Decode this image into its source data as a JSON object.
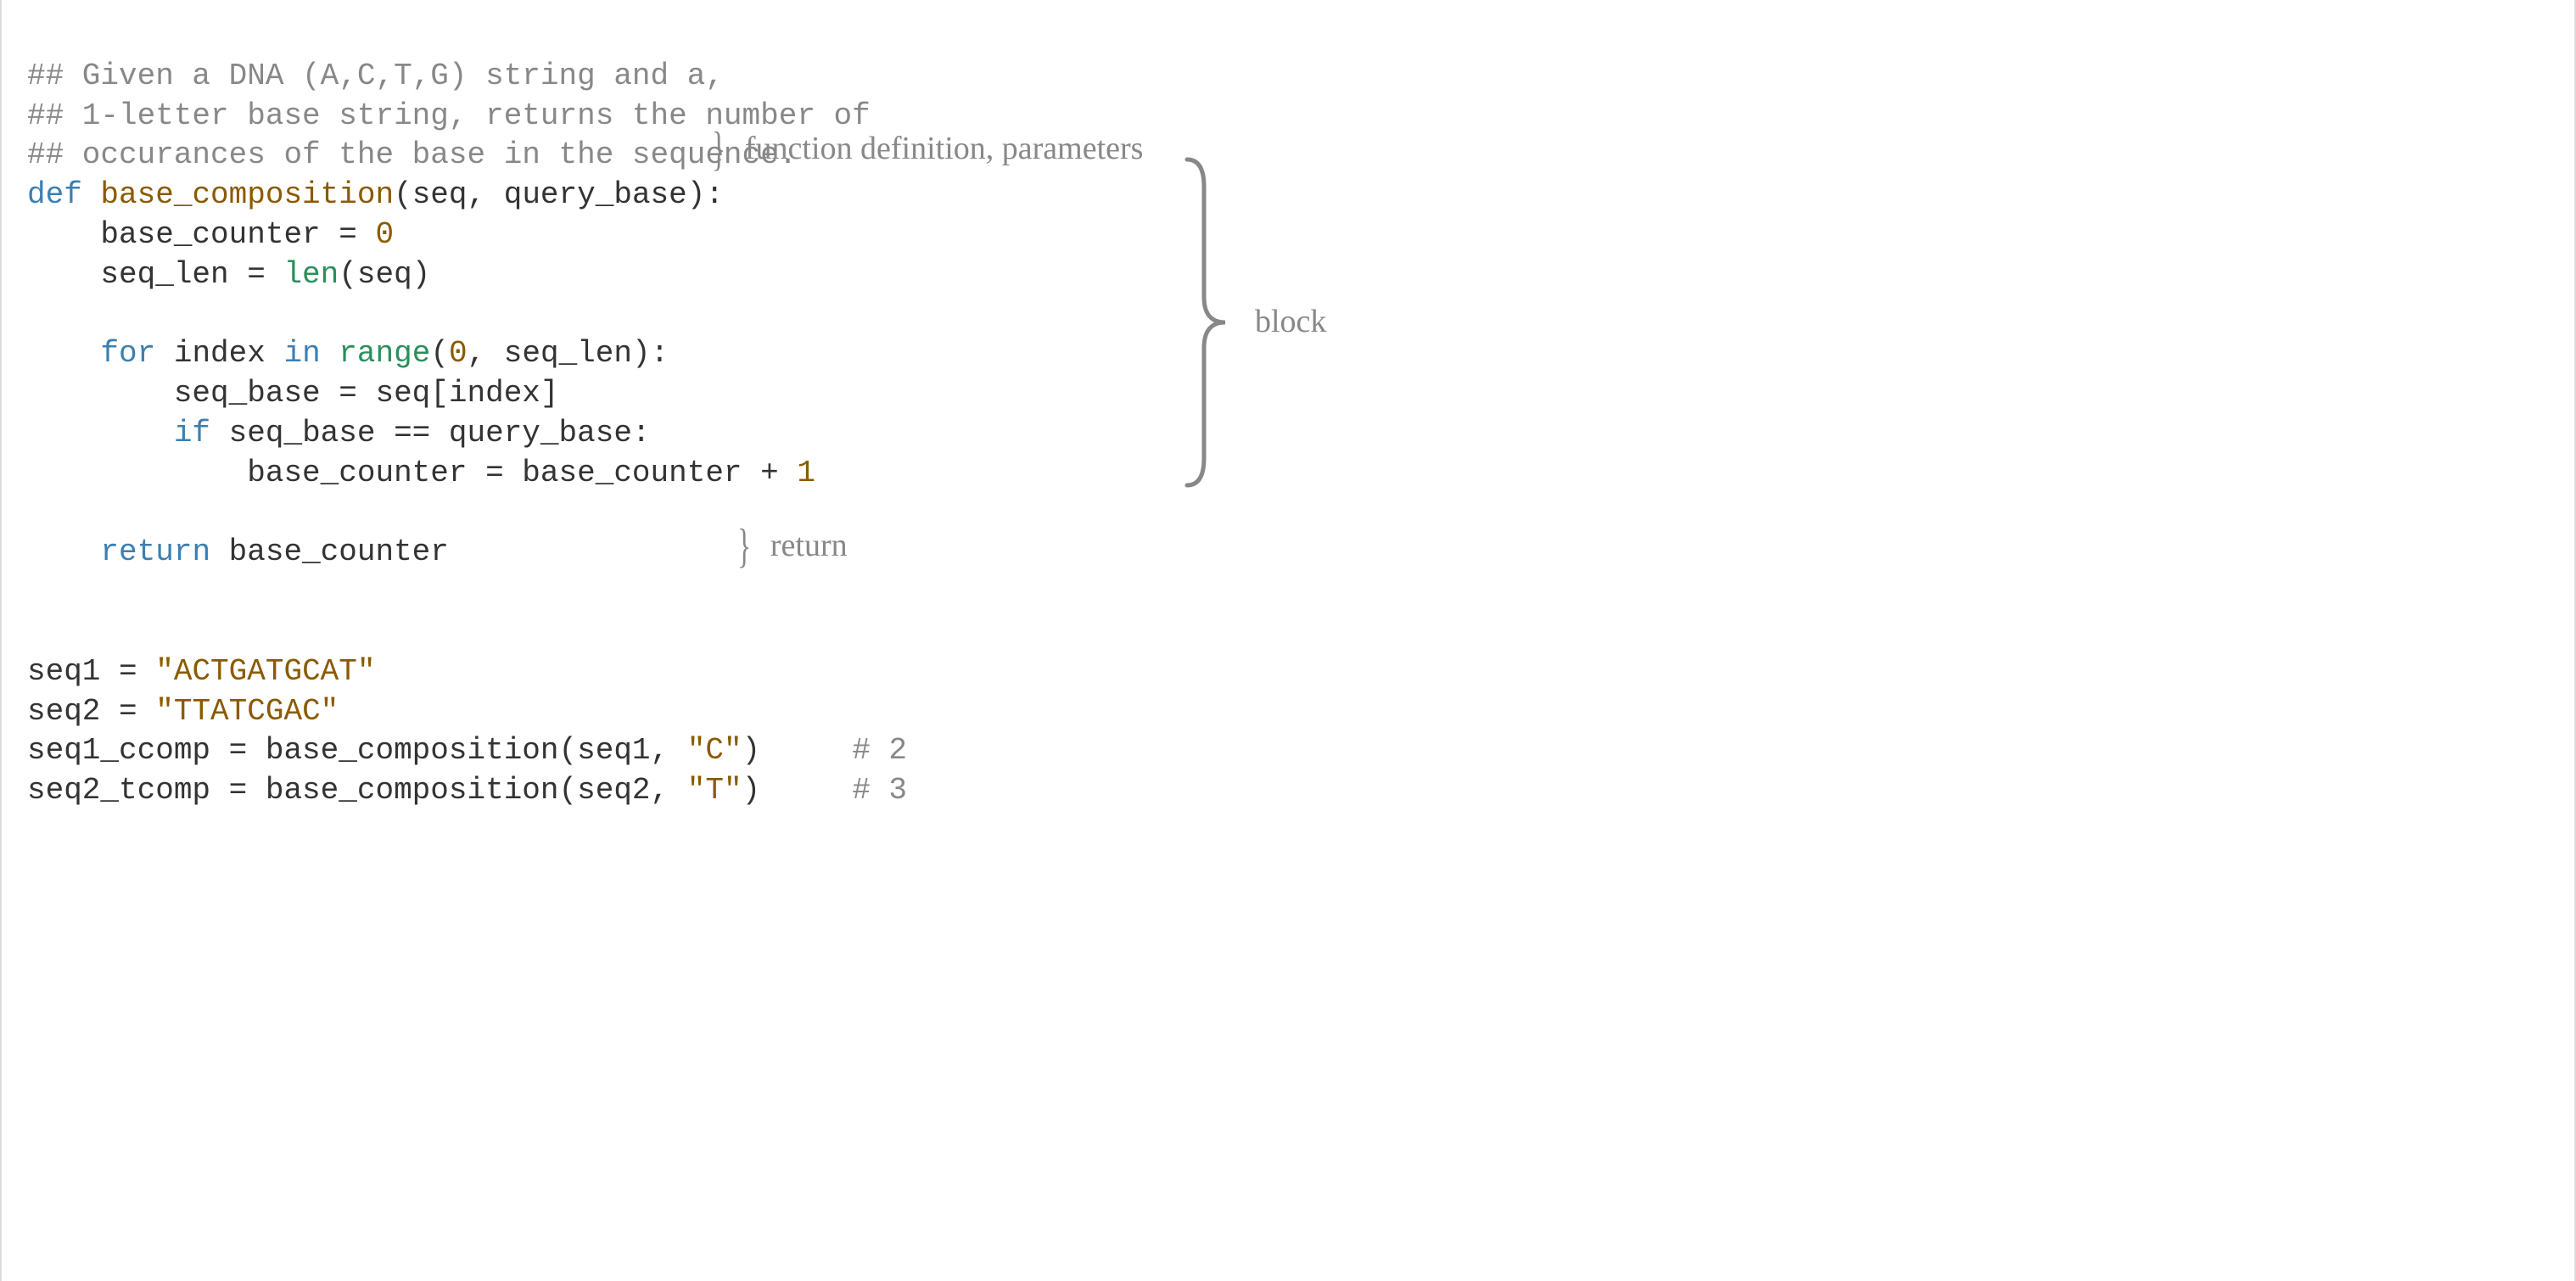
{
  "code": {
    "comment1": "## Given a DNA (A,C,T,G) string and a,",
    "comment2": "## 1-letter base string, returns the number of",
    "comment3": "## occurances of the base in the sequence.",
    "def_kw": "def",
    "func_name": "base_composition",
    "def_params_open": "(",
    "def_param1": "seq",
    "def_comma_space": ", ",
    "def_param2": "query_base",
    "def_params_close": "):",
    "line5_pre": "    base_counter = ",
    "line5_zero": "0",
    "line6_pre": "    seq_len = ",
    "line6_len": "len",
    "line6_post": "(seq)",
    "blank": "",
    "for_kw": "for",
    "for_var": " index ",
    "in_kw": "in",
    "for_space": " ",
    "range_fn": "range",
    "range_open": "(",
    "range_zero": "0",
    "range_rest": ", seq_len):",
    "line9": "        seq_base = seq[index]",
    "if_kw": "if",
    "if_cond": " seq_base == query_base:",
    "line11_pre": "            base_counter = base_counter + ",
    "line11_one": "1",
    "return_kw": "return",
    "return_val": " base_counter",
    "seq1_pre": "seq1 = ",
    "seq1_str": "\"ACTGATGCAT\"",
    "seq2_pre": "seq2 = ",
    "seq2_str": "\"TTATCGAC\"",
    "ccomp_pre": "seq1_ccomp = base_composition(seq1, ",
    "ccomp_str": "\"C\"",
    "ccomp_post": ")",
    "ccomp_pad": "     ",
    "ccomp_comment": "# 2",
    "tcomp_pre": "seq2_tcomp = base_composition(seq2, ",
    "tcomp_str": "\"T\"",
    "tcomp_post": ")",
    "tcomp_pad": "     ",
    "tcomp_comment": "# 3",
    "indent4": "    ",
    "indent8": "        "
  },
  "annotations": {
    "funcdef": "function definition, parameters",
    "block": "block",
    "return": "return"
  },
  "braces": {
    "small": "}"
  }
}
